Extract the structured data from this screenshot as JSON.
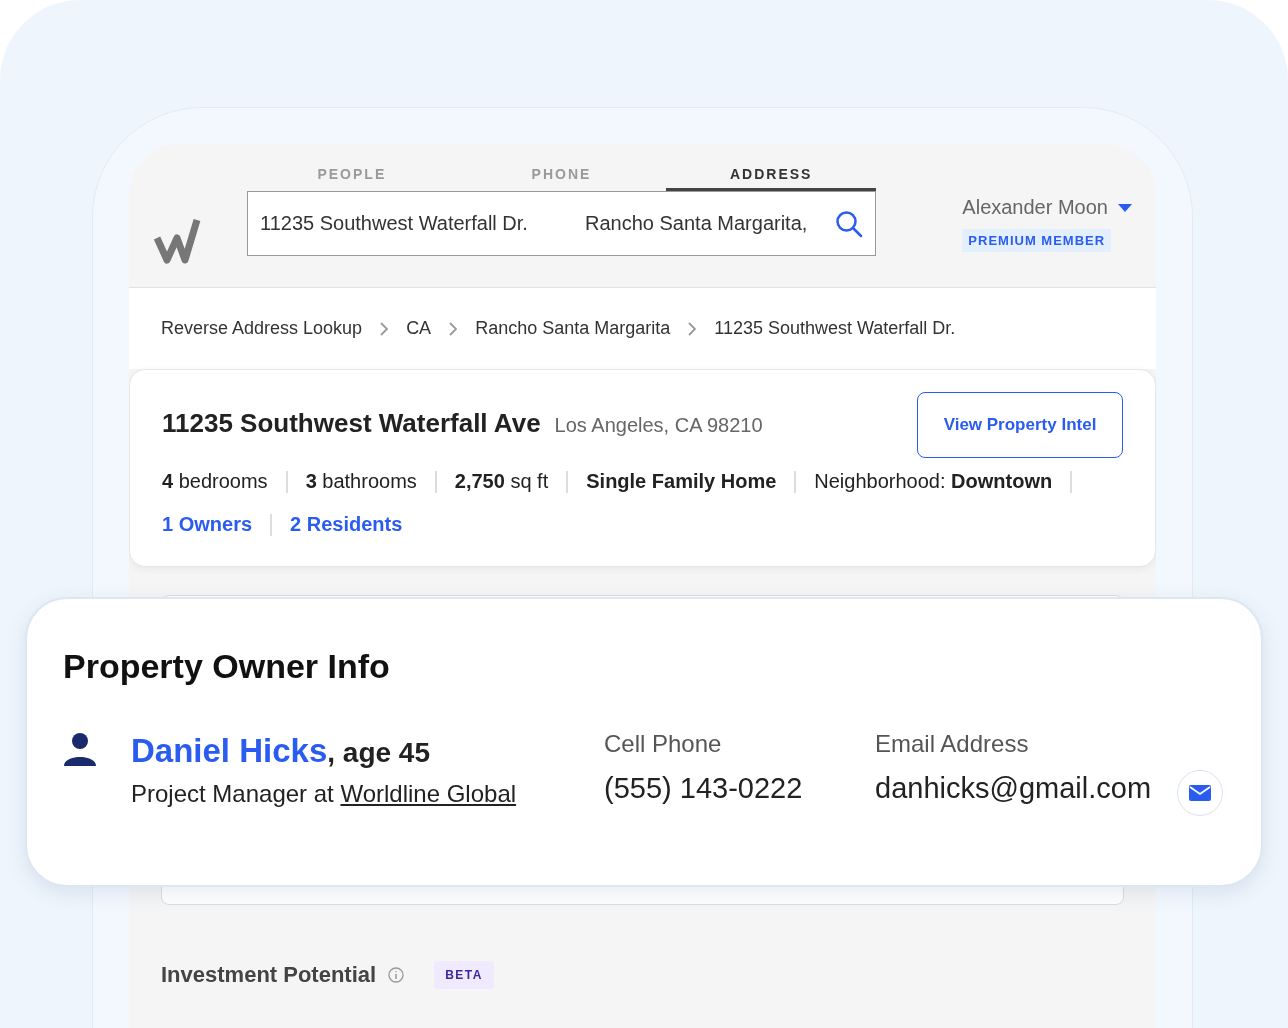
{
  "header": {
    "tabs": [
      {
        "label": "PEOPLE",
        "selected": false
      },
      {
        "label": "PHONE",
        "selected": false
      },
      {
        "label": "ADDRESS",
        "selected": true
      }
    ],
    "search": {
      "street": "11235 Southwest Waterfall Dr.",
      "city": "Rancho Santa Margarita,"
    },
    "user": {
      "name": "Alexander Moon",
      "badge": "PREMIUM MEMBER"
    }
  },
  "breadcrumbs": [
    "Reverse Address Lookup",
    "CA",
    "Rancho Santa Margarita",
    "11235 Southwest Waterfall Dr."
  ],
  "property": {
    "title": "11235 Southwest Waterfall Ave",
    "location": "Los Angeles, CA 98210",
    "button": "View Property Intel",
    "stats": [
      {
        "text": "**4** bedrooms",
        "strong": false
      },
      {
        "text": "**3** bathrooms",
        "strong": false
      },
      {
        "text": "**2,750** sq ft",
        "strong": false
      },
      {
        "text": "Single Family Home",
        "strong": true
      },
      {
        "text": "Neighborhood: **Downtown**",
        "strong": false
      }
    ],
    "links": [
      "1 Owners",
      "2 Residents"
    ]
  },
  "owner_card": {
    "title": "Property Owner Info",
    "name": "Daniel Hicks",
    "age": ", age 45",
    "job": "Project Manager at ",
    "company": "Worldline Global",
    "phone_label": "Cell Phone",
    "phone": "(555) 143-0222",
    "email_label": "Email Address",
    "email": "danhicks@gmail.com"
  },
  "investment": {
    "title": "Investment Potential",
    "badge": "BETA"
  }
}
